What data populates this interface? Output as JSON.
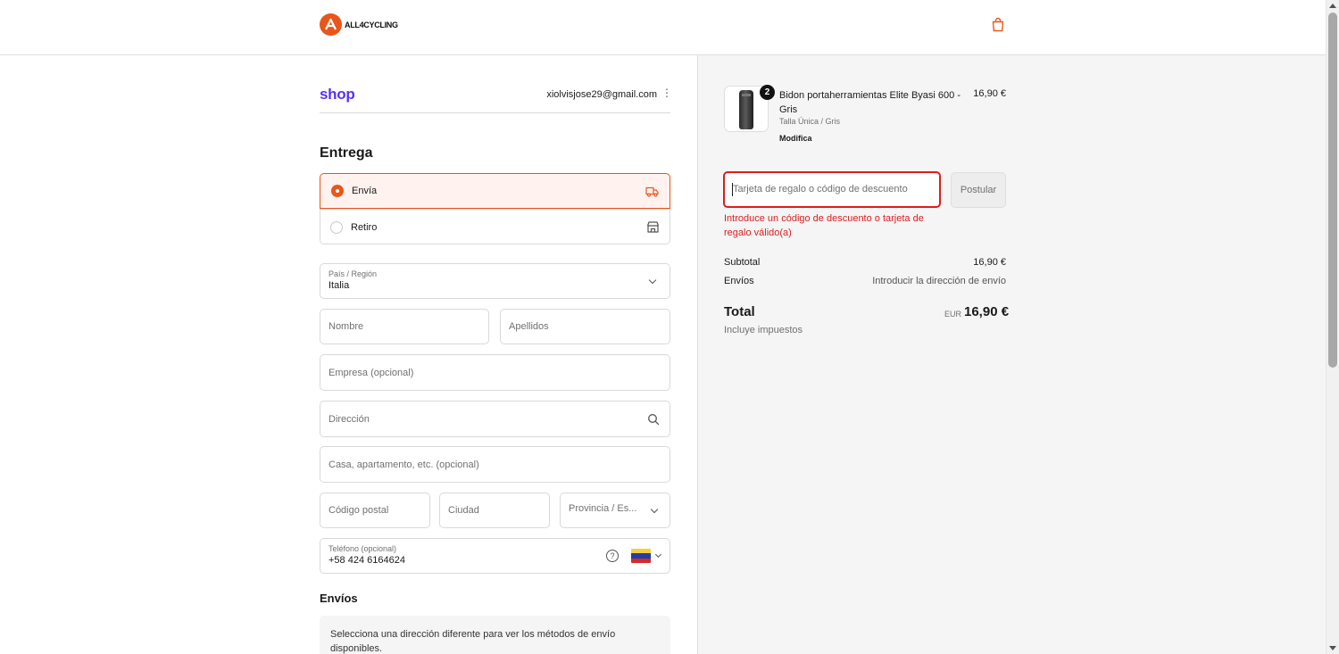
{
  "header": {
    "brand": "ALL4CYCLING",
    "cart_icon": "shopping-bag-icon"
  },
  "account": {
    "shop_label": "shop",
    "email": "xiolvisjose29@gmail.com",
    "menu_glyph": "⋮"
  },
  "delivery": {
    "heading": "Entrega",
    "options": [
      {
        "label": "Envía",
        "selected": true,
        "icon": "truck-icon"
      },
      {
        "label": "Retiro",
        "selected": false,
        "icon": "store-icon"
      }
    ]
  },
  "form": {
    "country": {
      "label": "País / Región",
      "value": "Italia"
    },
    "first_name": "Nombre",
    "last_name": "Apellidos",
    "company": "Empresa (opcional)",
    "address": "Dirección",
    "apartment": "Casa, apartamento, etc. (opcional)",
    "postal_code": "Código postal",
    "city": "Ciudad",
    "province": "Provincia / Es...",
    "phone": {
      "label": "Teléfono (opcional)",
      "value": "+58 424 6164624",
      "help": "?"
    }
  },
  "shipping": {
    "heading": "Envíos",
    "note": "Selecciona una dirección diferente para ver los métodos de envío disponibles."
  },
  "order": {
    "item": {
      "quantity": "2",
      "name": "Bidon portaherramientas Elite Byasi 600 - Gris",
      "variant": "Talla Única / Gris",
      "edit": "Modifica",
      "price": "16,90 €"
    },
    "discount": {
      "placeholder": "Tarjeta de regalo o código de descuento",
      "button": "Postular",
      "error": "Introduce un código de descuento o tarjeta de regalo válido(a)"
    },
    "subtotal": {
      "label": "Subtotal",
      "value": "16,90 €"
    },
    "shipping": {
      "label": "Envíos",
      "value": "Introducir la dirección de envío"
    },
    "total": {
      "label": "Total",
      "currency": "EUR",
      "value": "16,90 €",
      "note": "Incluye impuestos"
    }
  },
  "colors": {
    "accent": "#e8561b",
    "shop_purple": "#5a31f4",
    "error": "#dd1d1d"
  }
}
